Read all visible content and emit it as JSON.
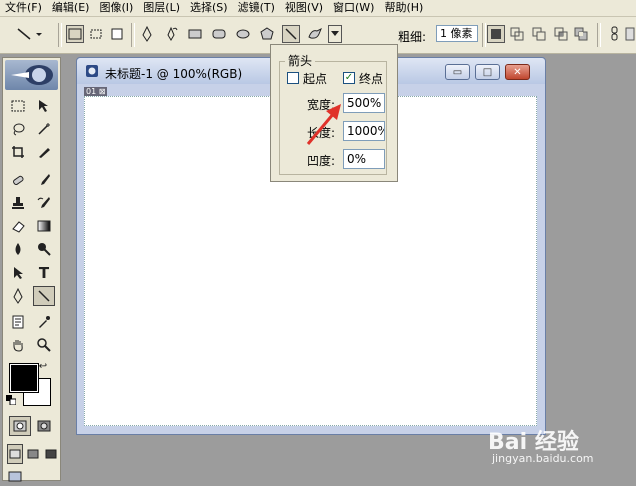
{
  "menubar": {
    "items": [
      "文件(F)",
      "编辑(E)",
      "图像(I)",
      "图层(L)",
      "选择(S)",
      "滤镜(T)",
      "视图(V)",
      "窗口(W)",
      "帮助(H)"
    ]
  },
  "options_bar": {
    "weight_label": "粗细:",
    "weight_value": "1 像素"
  },
  "document": {
    "title": "未标题-1 @ 100%(RGB)",
    "zoom_tag": "01 ⊠",
    "minimize_glyph": "▭",
    "maximize_glyph": "□",
    "close_glyph": "✕"
  },
  "arrowhead_popup": {
    "group_title": "箭头",
    "start_label": "起点",
    "start_checked": false,
    "end_label": "终点",
    "end_checked": true,
    "check_glyph": "✓",
    "width_label": "宽度:",
    "width_value": "500%",
    "length_label": "长度:",
    "length_value": "1000%",
    "concavity_label": "凹度:",
    "concavity_value": "0%"
  },
  "watermark": {
    "logo": "Bai 经验",
    "url": "jingyan.baidu.com"
  },
  "colors": {
    "foreground": "#000000",
    "background": "#ffffff",
    "annotation_arrow": "#e0322a"
  }
}
